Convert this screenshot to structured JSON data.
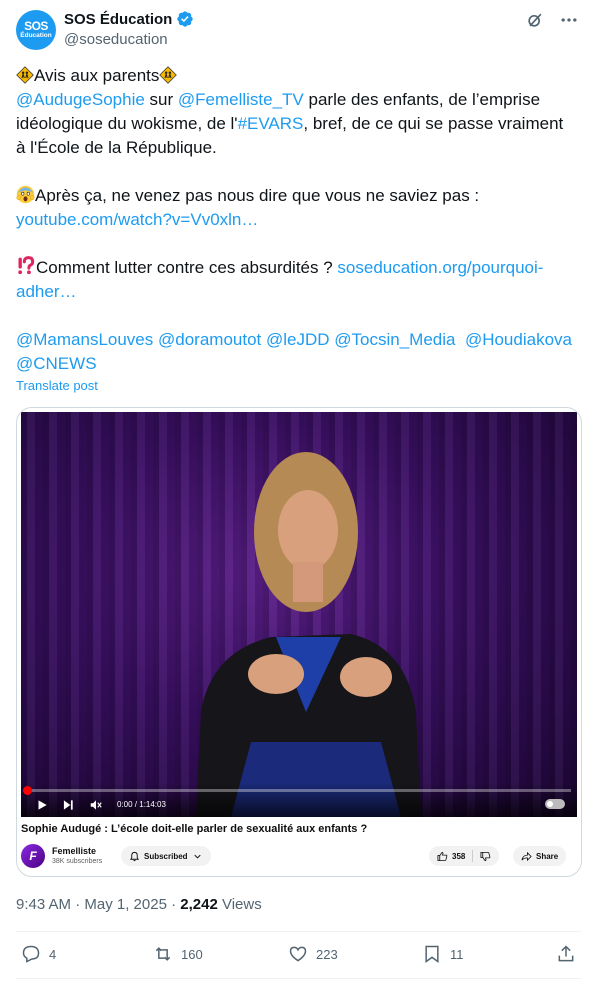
{
  "author": {
    "avatar_line1": "SOS",
    "avatar_line2": "Éducation",
    "display_name": "SOS Éducation",
    "handle": "@soseducation"
  },
  "tweet": {
    "line1_text": "Avis aux parents",
    "line2_mention1": "@AudugeSophie",
    "line2_mid": " sur ",
    "line2_mention2": "@Femelliste_TV",
    "line2_rest": " parle des enfants, de l’emprise",
    "line3_pre": "idéologique du wokisme, de l'",
    "line3_hashtag": "#EVARS",
    "line3_rest": ", bref, de ce qui se passe vraiment",
    "line4": "à l'École de la République.",
    "line6_text": "Après ça, ne venez pas nous dire que vous ne saviez pas :",
    "line7_link": "youtube.com/watch?v=Vv0xln…",
    "line9_text": "Comment lutter contre ces absurdités ? ",
    "line9_link": "soseducation.org/pourquoi-",
    "line10_link": "adher…",
    "mentions_line1": [
      "@MamansLouves",
      "@doramoutot",
      "@leJDD",
      "@Tocsin_Media",
      "@Houdiakova"
    ],
    "mentions_line2": "@CNEWS",
    "translate": "Translate post"
  },
  "video": {
    "time": "0:00 / 1:14:03",
    "progress_fraction": 0.0,
    "title": "Sophie Audugé : L’école doit-elle parler de sexualité aux enfants ?",
    "channel_initial": "F",
    "channel_name": "Femelliste",
    "channel_subs": "38K subscribers",
    "subscribed_label": "Subscribed",
    "likes": "358",
    "share_label": "Share"
  },
  "meta": {
    "time": "9:43 AM · May 1, 2025 · ",
    "views_count": "2,242",
    "views_label": " Views"
  },
  "actions": {
    "replies": "4",
    "reposts": "160",
    "likes": "223",
    "bookmarks": "11"
  },
  "colors": {
    "accent": "#1d9bf0",
    "text": "#0f1419",
    "muted": "#536471"
  }
}
